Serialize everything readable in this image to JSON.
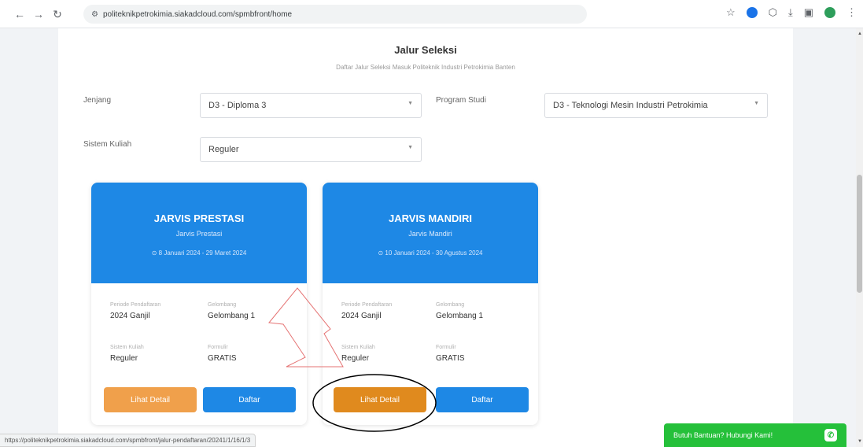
{
  "browser": {
    "url": "politeknikpetrokimia.siakadcloud.com/spmbfront/home",
    "status_url": "https://politeknikpetrokimia.siakadcloud.com/spmbfront/jalur-pendaftaran/20241/1/16/1/3"
  },
  "page": {
    "title": "Jalur Seleksi",
    "subtitle": "Daftar Jalur Seleksi Masuk Politeknik Industri Petrokimia Banten"
  },
  "filters": {
    "jenjang_label": "Jenjang",
    "jenjang_value": "D3 - Diploma 3",
    "prodi_label": "Program Studi",
    "prodi_value": "D3 - Teknologi Mesin Industri Petrokimia",
    "sistem_label": "Sistem Kuliah",
    "sistem_value": "Reguler"
  },
  "cards": [
    {
      "title": "JARVIS PRESTASI",
      "subtitle": "Jarvis Prestasi",
      "date": "⊙ 8 Januari 2024 - 29 Maret 2024",
      "periode_label": "Periode Pendaftaran",
      "periode_value": "2024 Ganjil",
      "gelombang_label": "Gelombang",
      "gelombang_value": "Gelombang 1",
      "sistem_label": "Sistem Kuliah",
      "sistem_value": "Reguler",
      "formulir_label": "Formulir",
      "formulir_value": "GRATIS",
      "detail_label": "Lihat Detail",
      "daftar_label": "Daftar"
    },
    {
      "title": "JARVIS MANDIRI",
      "subtitle": "Jarvis Mandiri",
      "date": "⊙ 10 Januari 2024 - 30 Agustus 2024",
      "periode_label": "Periode Pendaftaran",
      "periode_value": "2024 Ganjil",
      "gelombang_label": "Gelombang",
      "gelombang_value": "Gelombang 1",
      "sistem_label": "Sistem Kuliah",
      "sistem_value": "Reguler",
      "formulir_label": "Formulir",
      "formulir_value": "GRATIS",
      "detail_label": "Lihat Detail",
      "daftar_label": "Daftar"
    }
  ],
  "help": {
    "label": "Butuh Bantuan? Hubungi Kami!"
  },
  "colors": {
    "primary": "#1e88e5",
    "detail": "#f0a04b",
    "detail_active": "#e08a1e",
    "whatsapp": "#25c03a"
  }
}
